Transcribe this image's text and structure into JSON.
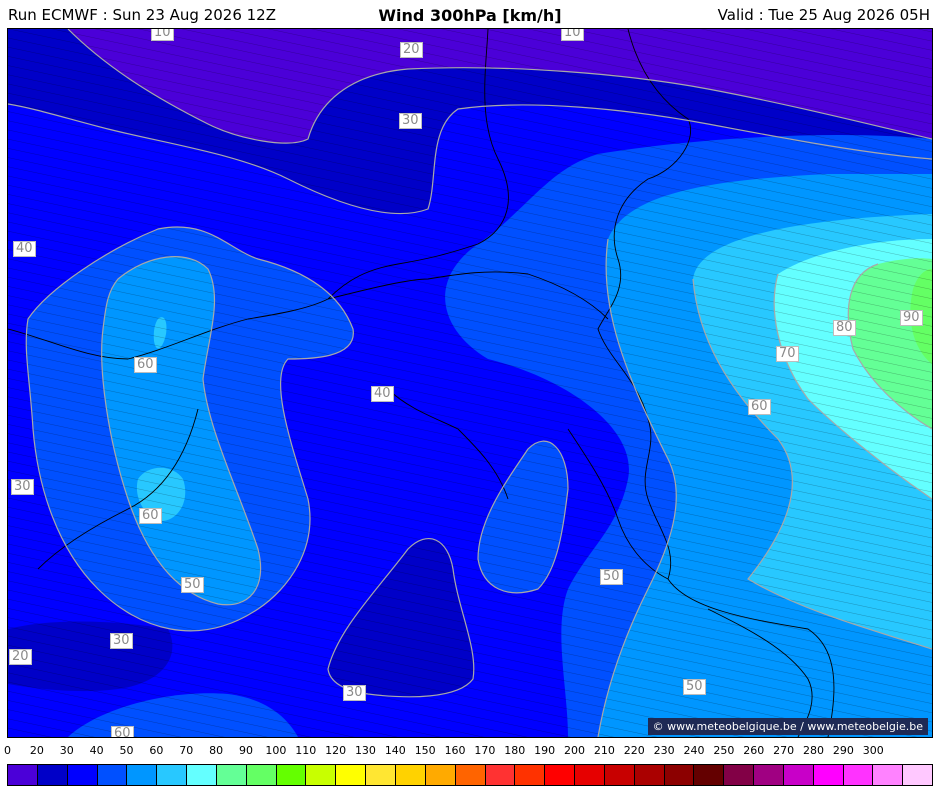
{
  "header": {
    "run": "Run ECMWF : Sun 23 Aug 2026 12Z",
    "title": "Wind 300hPa [km/h]",
    "valid": "Valid : Tue 25 Aug 2026 05H"
  },
  "map": {
    "contour_labels": [
      "10",
      "10",
      "20",
      "30",
      "40",
      "40",
      "60",
      "60",
      "30",
      "50",
      "30",
      "20",
      "30",
      "60",
      "50",
      "50",
      "60",
      "70",
      "80",
      "90"
    ],
    "copyright": "© www.meteobelgique.be / www.meteobelgie.be"
  },
  "legend": {
    "ticks": [
      "0",
      "20",
      "30",
      "40",
      "50",
      "60",
      "70",
      "80",
      "90",
      "100",
      "110",
      "120",
      "130",
      "140",
      "150",
      "160",
      "170",
      "180",
      "190",
      "200",
      "210",
      "220",
      "230",
      "240",
      "250",
      "260",
      "270",
      "280",
      "290",
      "300"
    ],
    "colors": [
      "#4b00d8",
      "#0000c8",
      "#0000ff",
      "#0050ff",
      "#0096ff",
      "#28c8ff",
      "#64ffff",
      "#64ff96",
      "#64ff64",
      "#64ff00",
      "#c8ff00",
      "#ffff00",
      "#ffe632",
      "#ffd200",
      "#ffaa00",
      "#ff6400",
      "#ff3232",
      "#ff3200",
      "#ff0000",
      "#e60000",
      "#c80000",
      "#aa0000",
      "#8c0000",
      "#640000",
      "#820046",
      "#a00082",
      "#c800c8",
      "#ff00ff",
      "#ff32ff",
      "#ff82ff",
      "#ffc8ff"
    ]
  }
}
